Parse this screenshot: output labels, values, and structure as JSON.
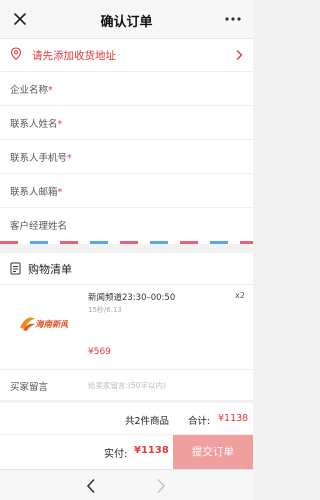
{
  "header": {
    "title": "确认订单",
    "close_icon": "close-icon",
    "more_icon": "more-dots-icon"
  },
  "address": {
    "prompt": "请先添加收货地址",
    "icon": "location-pin-icon"
  },
  "form": {
    "fields": [
      {
        "label": "企业名称",
        "required": true
      },
      {
        "label": "联系人姓名",
        "required": true
      },
      {
        "label": "联系人手机号",
        "required": true
      },
      {
        "label": "联系人邮箱",
        "required": true
      },
      {
        "label": "客户经理姓名",
        "required": false
      }
    ],
    "required_mark": "*"
  },
  "cart": {
    "title": "购物清单",
    "items": [
      {
        "name": "新闻频道23:30–00:50",
        "spec": "15秒/6.13",
        "quantity": "x2",
        "price": "¥569",
        "logo_text": "海南新闻"
      }
    ]
  },
  "note": {
    "label": "买家留言",
    "placeholder": "给卖家留言:(50字以内)"
  },
  "summary": {
    "count_text": "共2件商品",
    "total_label": "合计:",
    "total_value": "¥1138"
  },
  "paybar": {
    "paid_label": "实付:",
    "paid_value": "¥1138",
    "submit_label": "提交订单"
  },
  "colors": {
    "accent": "#e4393c",
    "submit_bg": "#ee9f9e",
    "stripe_red": "#e9627c",
    "stripe_blue": "#5ba7e6"
  }
}
